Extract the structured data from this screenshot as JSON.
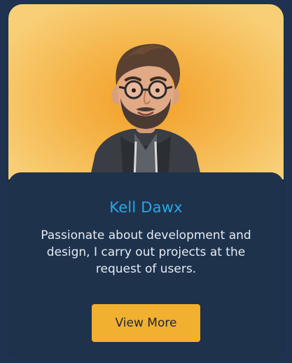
{
  "profile": {
    "name": "Kell Dawx",
    "description": "Passionate about development and design, I carry out projects at the request of users."
  },
  "actions": {
    "view_more_label": "View More"
  },
  "colors": {
    "page_background": "#1f3350",
    "card_background": "#1e324c",
    "hero_orange": "#f29f27",
    "hero_light": "#f8cf77",
    "name_blue": "#2aa6e6",
    "button_yellow": "#f1b02f"
  },
  "icons": {
    "avatar": "avatar"
  }
}
